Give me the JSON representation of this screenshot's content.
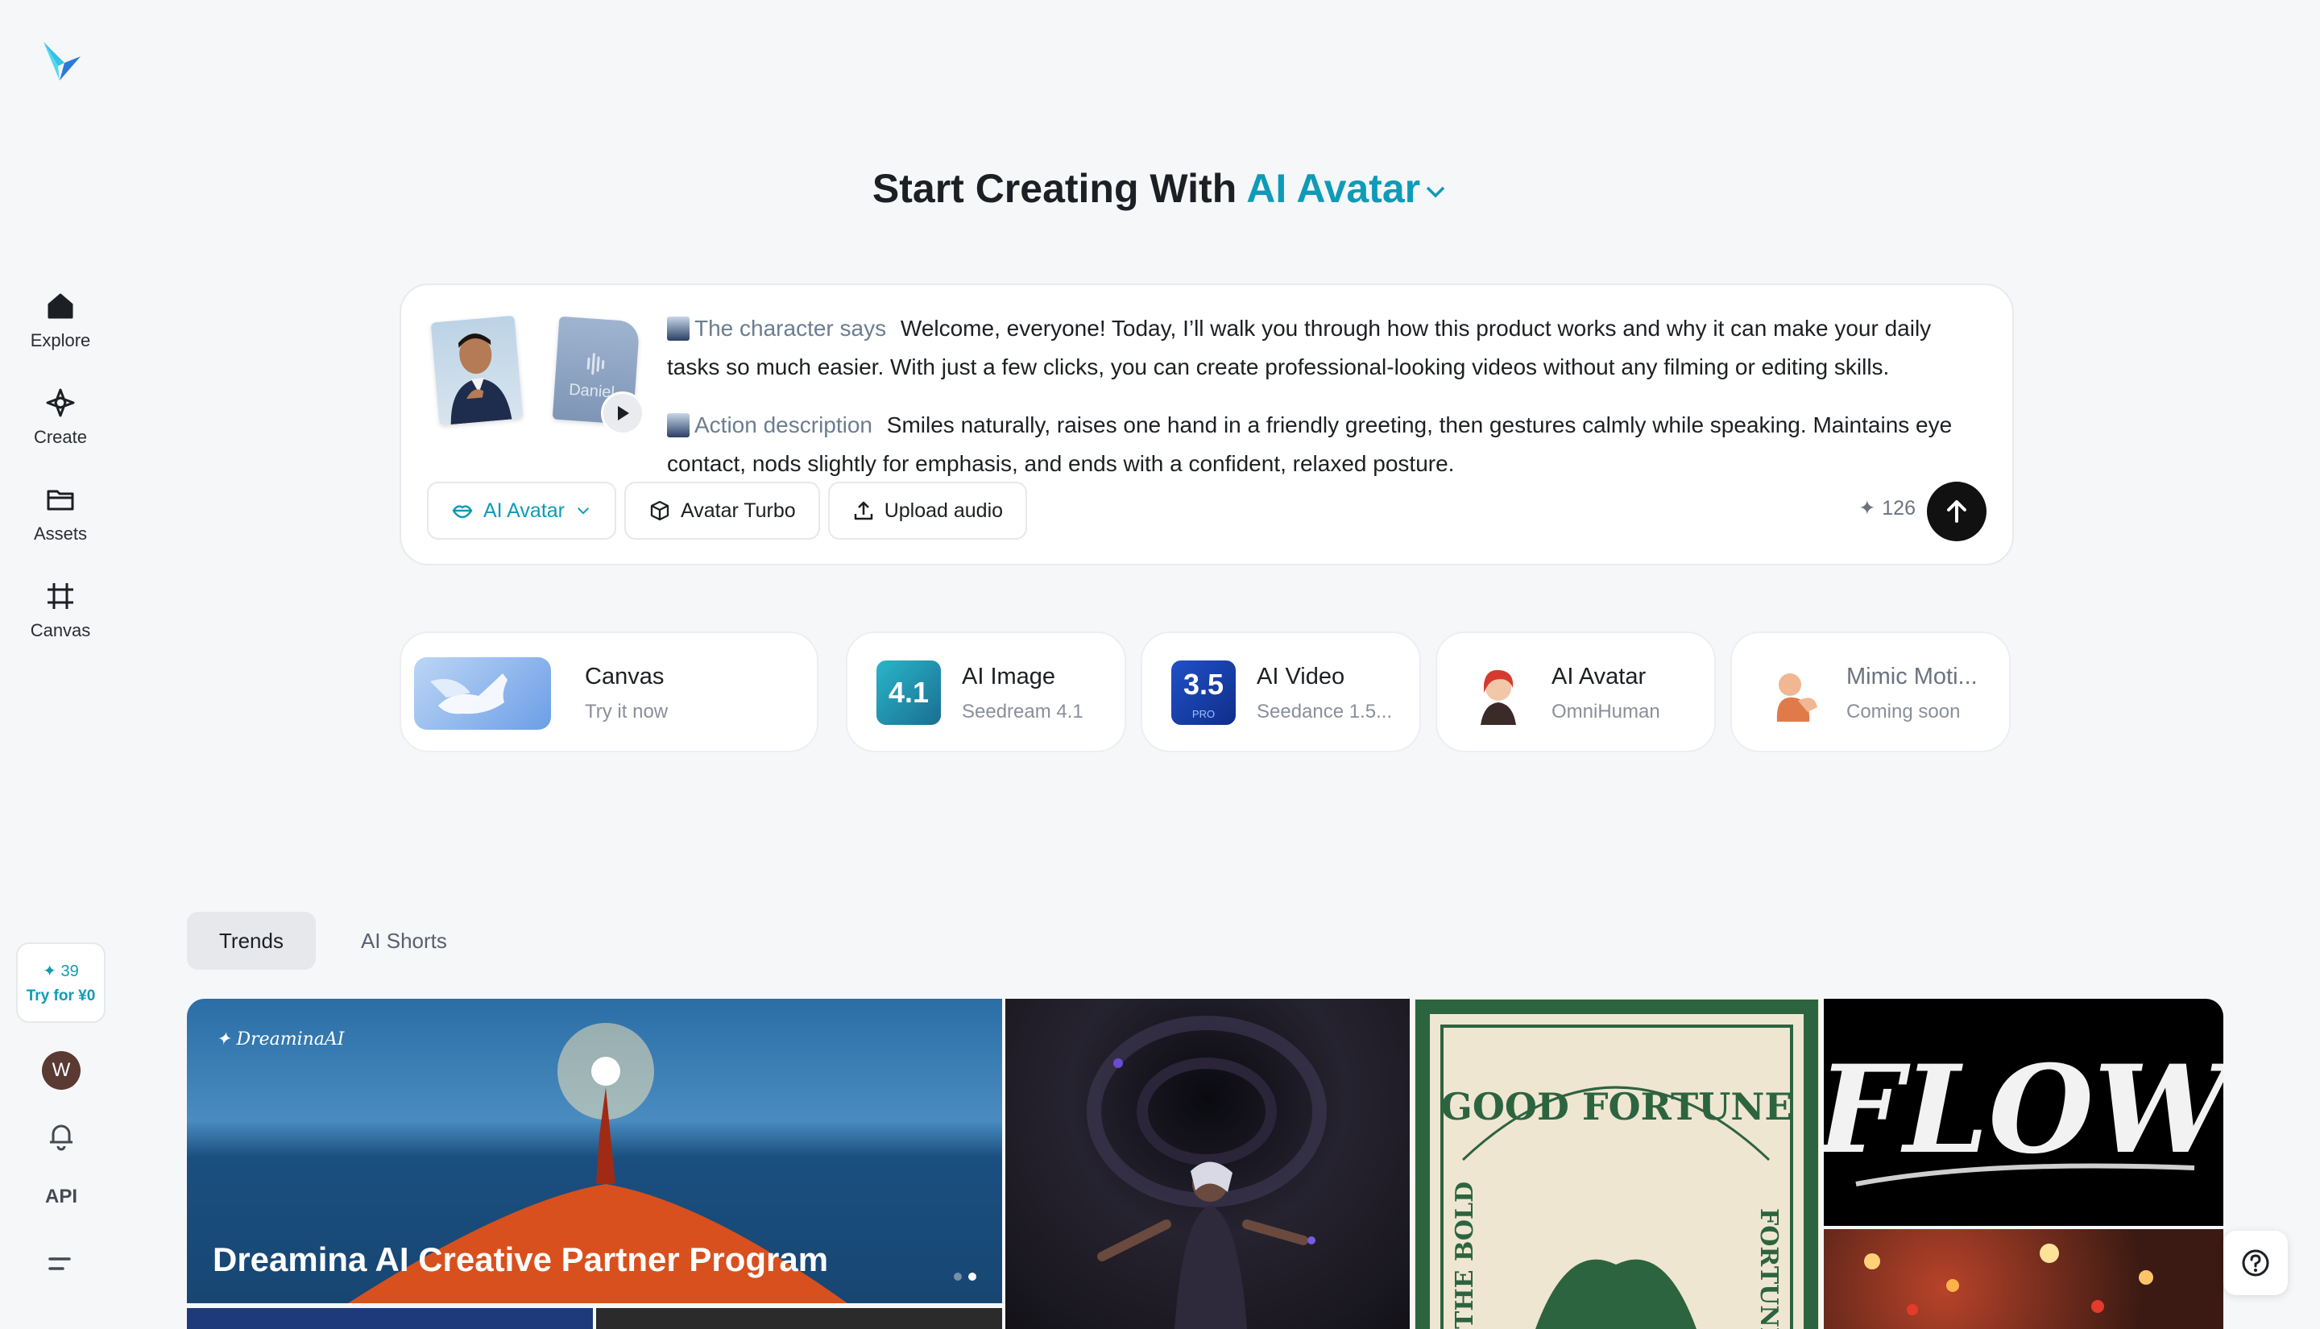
{
  "sidebar": {
    "items": [
      {
        "label": "Explore",
        "icon": "home-icon"
      },
      {
        "label": "Create",
        "icon": "sparkle-icon"
      },
      {
        "label": "Assets",
        "icon": "folder-icon"
      },
      {
        "label": "Canvas",
        "icon": "crop-icon"
      }
    ],
    "credits": "39",
    "try_label": "Try for ¥0",
    "avatar_letter": "W",
    "api_label": "API"
  },
  "heading": {
    "prefix": "Start Creating With",
    "mode": "AI Avatar"
  },
  "prompt": {
    "audio_name": "Daniel",
    "character_label": "The character says",
    "character_text": "Welcome, everyone! Today, I’ll walk you through how this product works and why it can make your daily tasks so much easier. With just a few clicks, you can create professional-looking videos without any filming or editing skills.",
    "action_label": "Action description",
    "action_text": "Smiles naturally, raises one hand in a friendly greeting, then gestures calmly while speaking. Maintains eye contact, nods slightly for emphasis, and ends with a confident, relaxed posture.",
    "mode_button": "AI Avatar",
    "model_button": "Avatar Turbo",
    "upload_button": "Upload audio",
    "cost": "126"
  },
  "tools": [
    {
      "title": "Canvas",
      "subtitle": "Try it now"
    },
    {
      "title": "AI Image",
      "subtitle": "Seedream 4.1",
      "badge": "4.1"
    },
    {
      "title": "AI Video",
      "subtitle": "Seedance 1.5...",
      "badge": "3.5",
      "badge_sub": "PRO"
    },
    {
      "title": "AI Avatar",
      "subtitle": "OmniHuman"
    },
    {
      "title": "Mimic Moti...",
      "subtitle": "Coming soon"
    }
  ],
  "tabs": [
    "Trends",
    "AI Shorts"
  ],
  "gallery": {
    "brand": "DreaminaAI",
    "banner_title": "Dreamina AI Creative Partner Program",
    "fortune_text": "GOOD FORTUNE",
    "fortune_left": "THE BOLD",
    "fortune_right": "FORTUNE F",
    "flow_text": "FLOW"
  },
  "colors": {
    "accent": "#0e9bb8",
    "background": "#f6f7f9",
    "send": "#111111"
  }
}
